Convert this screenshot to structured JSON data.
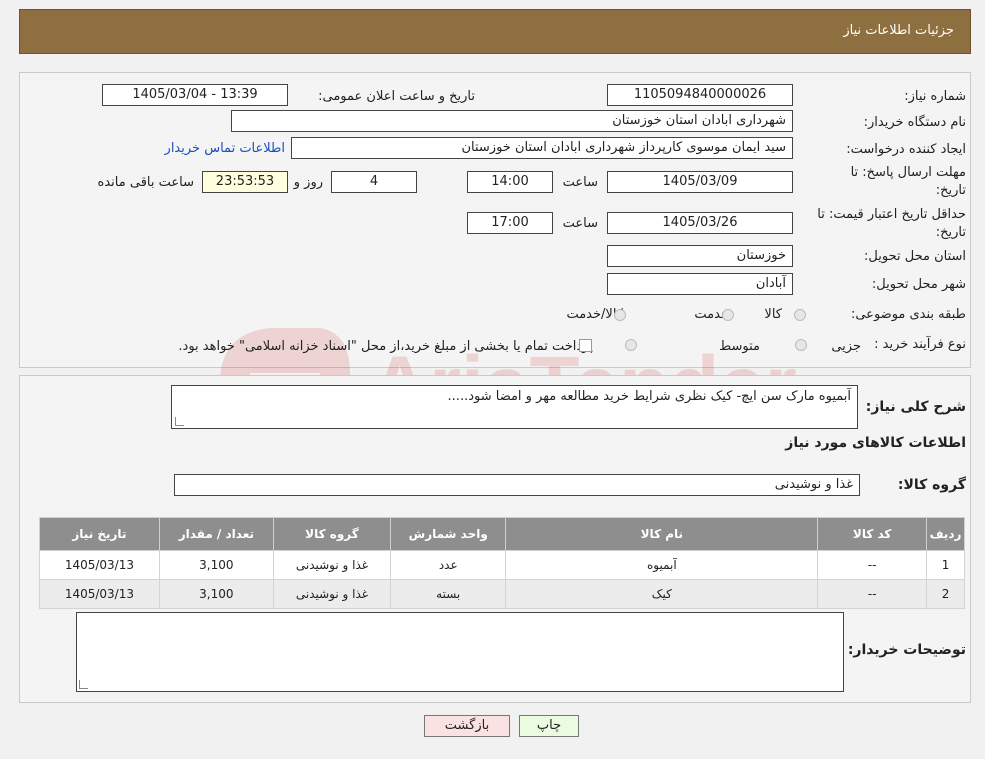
{
  "header": {
    "title": "جزئیات اطلاعات نیاز"
  },
  "form": {
    "need_number_label": "شماره نیاز:",
    "need_number": "1105094840000026",
    "announce_label": "تاریخ و ساعت اعلان عمومی:",
    "announce_value": "1405/03/04 - 13:39",
    "buyer_org_label": "نام دستگاه خریدار:",
    "buyer_org": "شهرداری ابادان استان خوزستان",
    "creator_label": "ایجاد کننده درخواست:",
    "creator": "سید ایمان موسوی کارپرداز شهرداری ابادان استان خوزستان",
    "contact_link": "اطلاعات تماس خریدار",
    "deadline_label_1": "مهلت ارسال پاسخ: تا",
    "deadline_label_2": "تاریخ:",
    "deadline_date": "1405/03/09",
    "time_label": "ساعت",
    "deadline_time": "14:00",
    "days": "4",
    "days_label": "روز و",
    "remaining_time": "23:53:53",
    "remaining_label": "ساعت باقی مانده",
    "validity_label_1": "حداقل تاریخ اعتبار قیمت: تا",
    "validity_label_2": "تاریخ:",
    "validity_date": "1405/03/26",
    "validity_time": "17:00",
    "province_label": "استان محل تحویل:",
    "province": "خوزستان",
    "city_label": "شهر محل تحویل:",
    "city": "آبادان",
    "category_label": "طبقه بندی موضوعی:",
    "category_options": [
      "کالا",
      "خدمت",
      "کالا/خدمت"
    ],
    "process_label": "نوع فرآیند خرید :",
    "process_options": [
      "جزیی",
      "متوسط"
    ],
    "payment_note": "پرداخت تمام یا بخشی از مبلغ خرید،از محل \"اسناد خزانه اسلامی\" خواهد بود."
  },
  "details": {
    "summary_label": "شرح کلی نیاز:",
    "summary": "آبمیوه مارک سن ایچ- کیک نظری شرایط خرید مطالعه مهر و امضا شود.....",
    "goods_title": "اطلاعات کالاهای مورد نیاز",
    "group_label": "گروه کالا:",
    "group_value": "غذا و نوشیدنی",
    "table": {
      "headers": [
        "ردیف",
        "کد کالا",
        "نام کالا",
        "واحد شمارش",
        "گروه کالا",
        "تعداد / مقدار",
        "تاریخ نیاز"
      ],
      "rows": [
        [
          "1",
          "--",
          "آبمیوه",
          "عدد",
          "غذا و نوشیدنی",
          "3,100",
          "1405/03/13"
        ],
        [
          "2",
          "--",
          "کیک",
          "بسته",
          "غذا و نوشیدنی",
          "3,100",
          "1405/03/13"
        ]
      ]
    },
    "buyer_notes_label": "توضیحات خریدار:",
    "buyer_notes": ""
  },
  "buttons": {
    "print": "چاپ",
    "back": "بازگشت"
  }
}
